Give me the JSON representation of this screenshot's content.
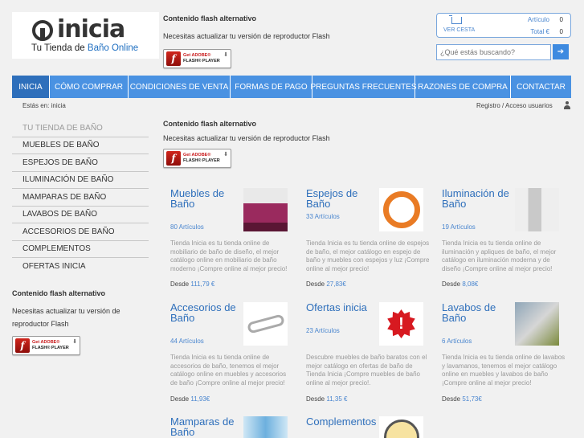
{
  "logo": {
    "word": "inicia",
    "tag_prefix": "Tu Tienda de ",
    "tag_highlight": "Baño Online"
  },
  "flash": {
    "title": "Contenido flash alternativo",
    "text": "Necesitas actualizar tu versión de reproductor Flash",
    "text_line1": "Necesitas actualizar tu versión de",
    "text_line2": "reproductor Flash",
    "btn_get": "Get ADOBE®",
    "btn_player": "FLASH® PLAYER"
  },
  "cart": {
    "link": "VER CESTA",
    "articles_label": "Artículo",
    "articles_value": "0",
    "total_label": "Total €",
    "total_value": "0"
  },
  "search": {
    "placeholder": "¿Qué estás buscando?"
  },
  "nav": [
    {
      "label": "INICIA"
    },
    {
      "label": "CÓMO COMPRAR"
    },
    {
      "label": "CONDICIONES DE VENTA"
    },
    {
      "label": "FORMAS DE PAGO"
    },
    {
      "label": "PREGUNTAS FRECUENTES"
    },
    {
      "label": "RAZONES DE COMPRA"
    },
    {
      "label": "CONTACTAR"
    }
  ],
  "breadcrumb": {
    "prefix": "Estás en:",
    "current": "inicia"
  },
  "account": {
    "link": "Registro / Acceso usuarios"
  },
  "sidebar": [
    "TU TIENDA DE BAÑO",
    "MUEBLES DE BAÑO",
    "ESPEJOS DE BAÑO",
    "ILUMINACIÓN DE BAÑO",
    "MAMPARAS DE BAÑO",
    "LAVABOS DE BAÑO",
    "ACCESORIOS DE BAÑO",
    "COMPLEMENTOS",
    "OFERTAS INICIA"
  ],
  "products": [
    {
      "title": "Muebles de Baño",
      "count": "80 Artículos",
      "desc": "Tienda Inicia es tu tienda online de mobiliario de baño de diseño, el mejor catálogo online en mobiliario de baño moderno ¡Compre online al mejor precio!",
      "price_label": "Desde",
      "price": "111,79 €"
    },
    {
      "title": "Espejos de Baño",
      "count": "33 Artículos",
      "desc": "Tienda Inicia es tu tienda online de espejos de baño, el mejor catálogo en espejo de baño y muebles con espejos y luz ¡Compre online al mejor precio!",
      "price_label": "Desde",
      "price": "27,83€"
    },
    {
      "title": "Iluminación de Baño",
      "count": "19 Artículos",
      "desc": "Tienda Inicia es tu tienda online de iluminación y apliques de baño, el mejor catálogo en iluminación moderna y de diseño ¡Compre online al mejor precio!",
      "price_label": "Desde",
      "price": "8,08€"
    },
    {
      "title": "Accesorios de Baño",
      "count": "44 Artículos",
      "desc": "Tienda Inicia es tu tienda online de accesorios de baño, tenemos el mejor catálogo online en muebles y accesorios de baño ¡Compre online al mejor precio!",
      "price_label": "Desde",
      "price": "11,93€"
    },
    {
      "title": "Ofertas inicia",
      "count": "23 Artículos",
      "desc": "Descubre muebles de baño baratos con el mejor catálogo en ofertas de baño de Tienda Inicia ¡Compre muebles de baño online al mejor precio!.",
      "price_label": "Desde",
      "price": "11,35 €"
    },
    {
      "title": "Lavabos de Baño",
      "count": "6 Artículos",
      "desc": "Tienda Inicia es tu tienda online de lavabos y lavamanos, tenemos el mejor catálogo online en muebles y lavabos de baño ¡Compre online al mejor precio!",
      "price_label": "Desde",
      "price": "51,73€"
    },
    {
      "title": "Mamparas de Baño"
    },
    {
      "title": "Complementos"
    }
  ]
}
